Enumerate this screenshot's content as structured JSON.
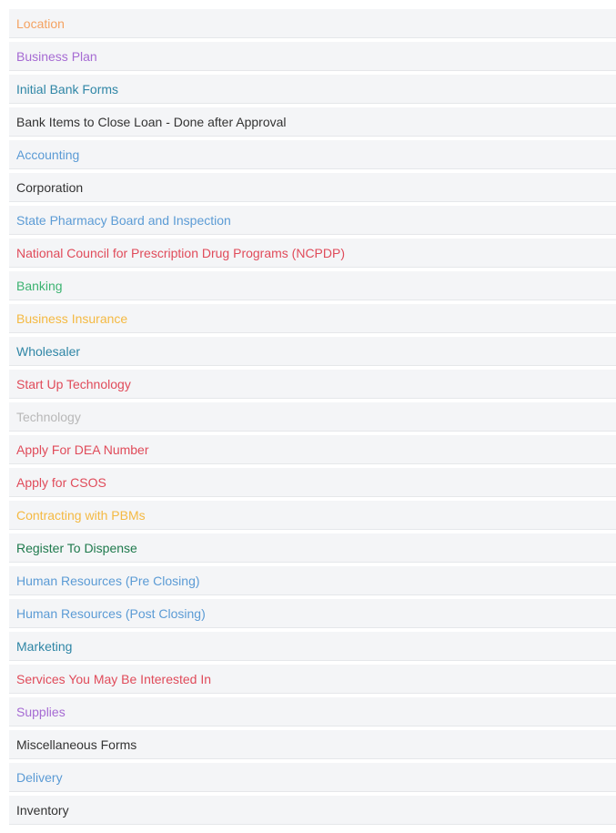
{
  "items": [
    {
      "label": "Location",
      "color": "#f4a261"
    },
    {
      "label": "Business Plan",
      "color": "#a66bd3"
    },
    {
      "label": "Initial Bank Forms",
      "color": "#2f86a6"
    },
    {
      "label": "Bank Items to Close Loan - Done after Approval",
      "color": "#333333"
    },
    {
      "label": "Accounting",
      "color": "#5b9bd5"
    },
    {
      "label": "Corporation",
      "color": "#333333"
    },
    {
      "label": "State Pharmacy Board and Inspection",
      "color": "#5b9bd5"
    },
    {
      "label": "National Council for Prescription Drug Programs (NCPDP)",
      "color": "#e04b5a"
    },
    {
      "label": "Banking",
      "color": "#3cb371"
    },
    {
      "label": "Business Insurance",
      "color": "#f4b942"
    },
    {
      "label": "Wholesaler",
      "color": "#2f86a6"
    },
    {
      "label": "Start Up Technology",
      "color": "#e04b5a"
    },
    {
      "label": "Technology",
      "color": "#b8b8b8"
    },
    {
      "label": "Apply For DEA Number",
      "color": "#e04b5a"
    },
    {
      "label": "Apply for CSOS",
      "color": "#e04b5a"
    },
    {
      "label": "Contracting with PBMs",
      "color": "#f4b942"
    },
    {
      "label": "Register To Dispense",
      "color": "#1f7a4d"
    },
    {
      "label": "Human Resources (Pre Closing)",
      "color": "#5b9bd5"
    },
    {
      "label": "Human Resources (Post Closing)",
      "color": "#5b9bd5"
    },
    {
      "label": "Marketing",
      "color": "#2f86a6"
    },
    {
      "label": "Services You May Be Interested In",
      "color": "#e04b5a"
    },
    {
      "label": "Supplies",
      "color": "#a66bd3"
    },
    {
      "label": "Miscellaneous Forms",
      "color": "#333333"
    },
    {
      "label": "Delivery",
      "color": "#5b9bd5"
    },
    {
      "label": "Inventory",
      "color": "#333333"
    }
  ]
}
